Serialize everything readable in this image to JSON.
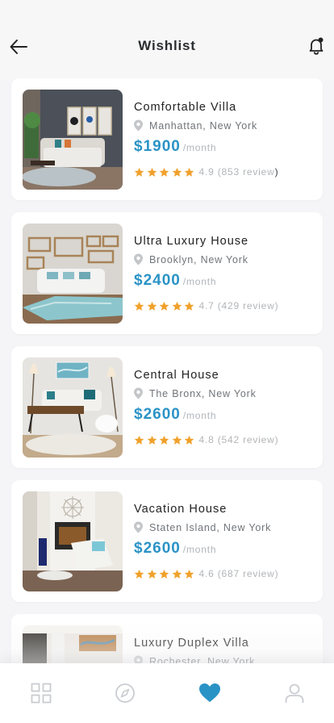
{
  "header": {
    "title": "Wishlist",
    "back_icon": "arrow-left-icon",
    "bell_icon": "bell-icon",
    "notification_dot_color": "#1f2326"
  },
  "colors": {
    "accent": "#2a93c6",
    "star": "#f0a12b",
    "nav_active": "#2a93c6",
    "nav_inactive": "#c9ccd0"
  },
  "wishlist": [
    {
      "title": "Comfortable Villa",
      "location": "Manhattan, New York",
      "price": "$1900",
      "unit": "/month",
      "stars": 5,
      "rating": "4.9",
      "reviews": "853 review",
      "paren_open": "(",
      "paren_close": ")"
    },
    {
      "title": "Ultra Luxury House",
      "location": "Brooklyn, New York",
      "price": "$2400",
      "unit": "/month",
      "stars": 5,
      "rating": "4.7",
      "reviews": "429 review",
      "paren_open": "(",
      "paren_close": ")"
    },
    {
      "title": "Central House",
      "location": "The Bronx, New York",
      "price": "$2600",
      "unit": "/month",
      "stars": 5,
      "rating": "4.8",
      "reviews": "542 review",
      "paren_open": "(",
      "paren_close": ")"
    },
    {
      "title": "Vacation House",
      "location": "Staten Island, New York",
      "price": "$2600",
      "unit": "/month",
      "stars": 5,
      "rating": "4.6",
      "reviews": "687 review",
      "paren_open": "(",
      "paren_close": ")"
    },
    {
      "title": "Luxury Duplex Villa",
      "location": "Rochester, New York"
    }
  ],
  "bottom_nav": [
    {
      "icon": "grid-icon",
      "active": false
    },
    {
      "icon": "compass-icon",
      "active": false
    },
    {
      "icon": "heart-icon",
      "active": true
    },
    {
      "icon": "user-icon",
      "active": false
    }
  ]
}
